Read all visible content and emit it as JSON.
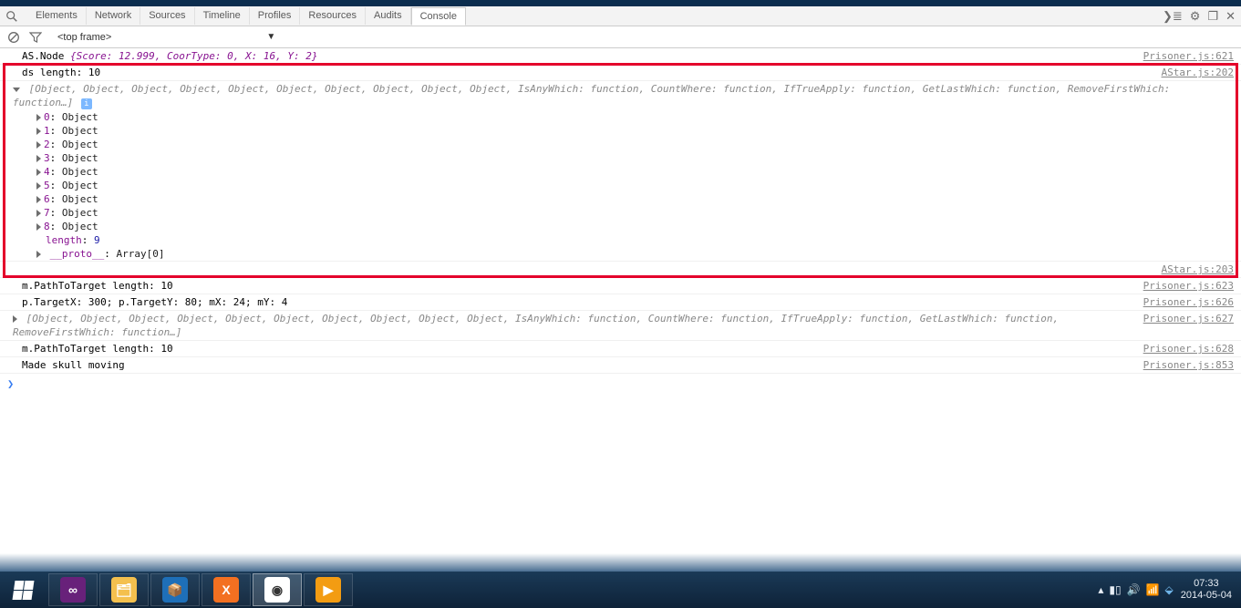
{
  "tabs": [
    "Elements",
    "Network",
    "Sources",
    "Timeline",
    "Profiles",
    "Resources",
    "Audits",
    "Console"
  ],
  "active_tab_index": 7,
  "frame_selector": "<top frame>",
  "console_top": {
    "prefix": "AS.Node ",
    "body": "{Score: 12.999, CoorType: 0, X: 16, Y: 2}",
    "src": "Prisoner.js:621"
  },
  "ds_length": {
    "text": "ds length: 10",
    "src": "AStar.js:202"
  },
  "array_summary": "[Object, Object, Object, Object, Object, Object, Object, Object, Object, Object, IsAnyWhich: function, CountWhere: function, IfTrueApply: function, GetLastWhich: function, RemoveFirstWhich: function…]",
  "array_items": [
    {
      "k": "0",
      "v": "Object"
    },
    {
      "k": "1",
      "v": "Object"
    },
    {
      "k": "2",
      "v": "Object"
    },
    {
      "k": "3",
      "v": "Object"
    },
    {
      "k": "4",
      "v": "Object"
    },
    {
      "k": "5",
      "v": "Object"
    },
    {
      "k": "6",
      "v": "Object"
    },
    {
      "k": "7",
      "v": "Object"
    },
    {
      "k": "8",
      "v": "Object"
    }
  ],
  "array_length": {
    "k": "length",
    "v": "9"
  },
  "array_proto": {
    "k": "__proto__",
    "v": "Array[0]"
  },
  "array_src": "AStar.js:203",
  "m_path": {
    "text": "m.PathToTarget length: 10",
    "src": "Prisoner.js:623"
  },
  "p_target": {
    "text": "p.TargetX: 300; p.TargetY: 80; mX: 24; mY: 4",
    "src": "Prisoner.js:626"
  },
  "array_summary2": "[Object, Object, Object, Object, Object, Object, Object, Object, Object, Object, IsAnyWhich: function, CountWhere: function, IfTrueApply: function, GetLastWhich: function, RemoveFirstWhich: function…]",
  "array_src2": "Prisoner.js:627",
  "m_path2": {
    "text": "m.PathToTarget length: 10",
    "src": "Prisoner.js:628"
  },
  "made_skull": {
    "text": "Made skull moving",
    "src": "Prisoner.js:853"
  },
  "clock": {
    "time": "07:33",
    "date": "2014-05-04"
  }
}
